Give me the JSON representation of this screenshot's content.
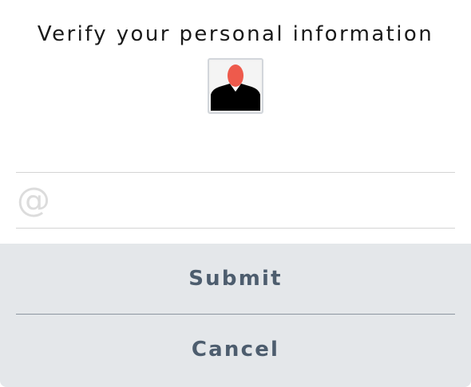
{
  "dialog": {
    "title": "Verify your personal information",
    "avatar_icon": "person-silhouette-icon",
    "email": {
      "icon_symbol": "@",
      "icon": "at-sign-icon",
      "value": "",
      "placeholder": ""
    },
    "actions": {
      "submit_label": "Submit",
      "cancel_label": "Cancel"
    }
  },
  "colors": {
    "title_text": "#1a1a1a",
    "avatar_head": "#ee5a4c",
    "avatar_body": "#000000",
    "actions_background": "#e4e7ea",
    "button_text": "#4d5d6e",
    "divider": "#d4d4d4"
  }
}
